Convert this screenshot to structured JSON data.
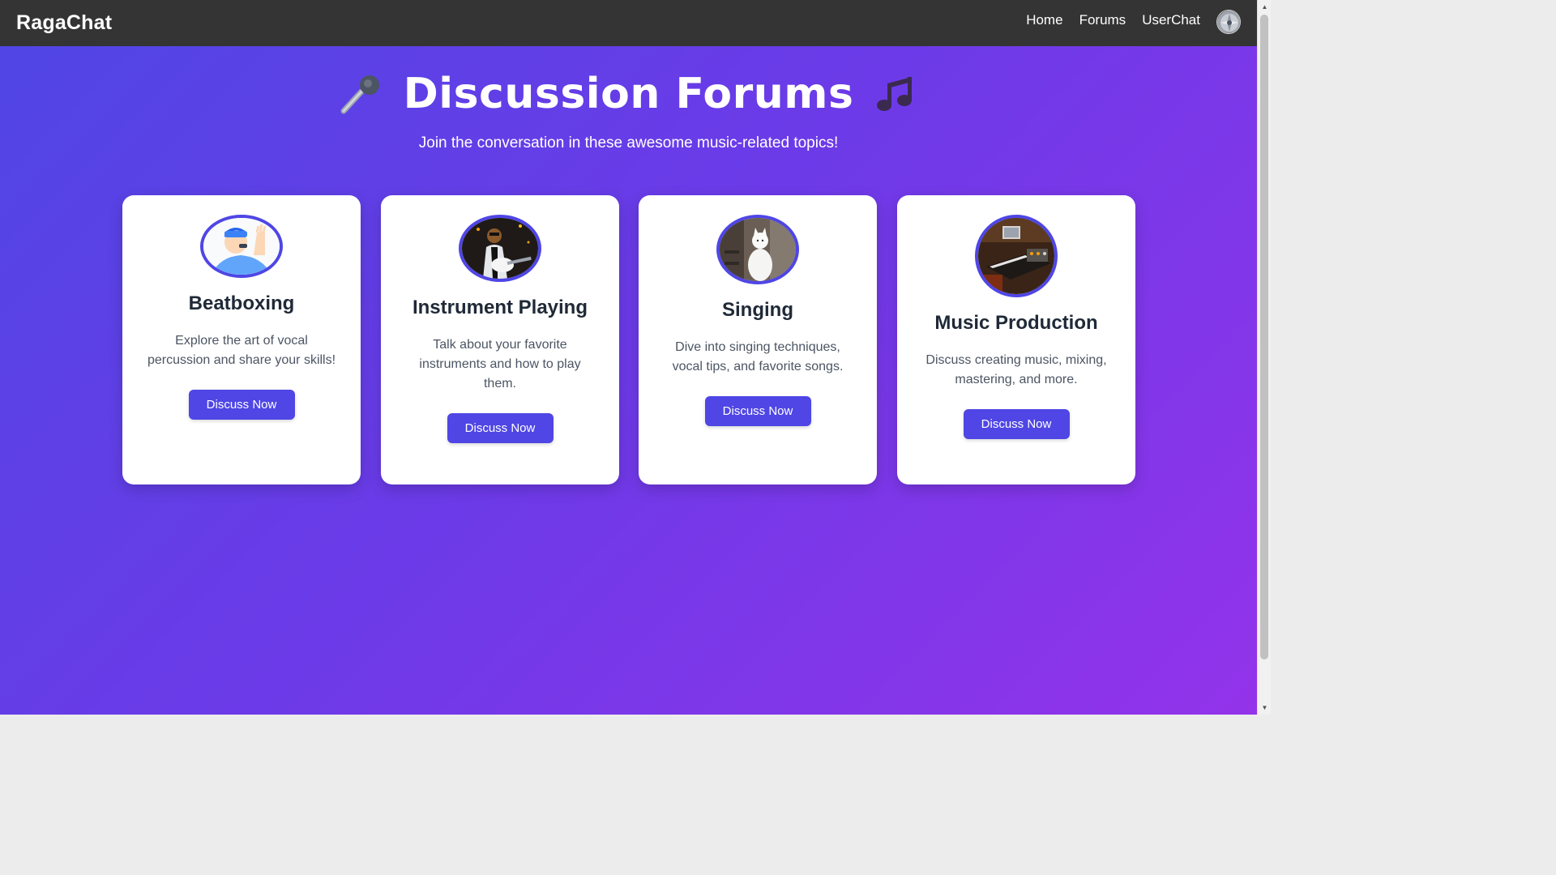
{
  "navbar": {
    "brand": "RagaChat",
    "links": [
      "Home",
      "Forums",
      "UserChat"
    ],
    "avatar": "user-avatar-icon"
  },
  "hero": {
    "title": "Discussion Forums",
    "left_emoji": "microphone-icon",
    "right_emoji": "musical-notes-icon",
    "subtitle": "Join the conversation in these awesome music-related topics!"
  },
  "cards": [
    {
      "title": "Beatboxing",
      "description": "Explore the art of vocal percussion and share your skills!",
      "button": "Discuss Now",
      "image": "beatboxer-cartoon-image"
    },
    {
      "title": "Instrument Playing",
      "description": "Talk about your favorite instruments and how to play them.",
      "button": "Discuss Now",
      "image": "guitar-player-photo"
    },
    {
      "title": "Singing",
      "description": "Dive into singing techniques, vocal tips, and favorite songs.",
      "button": "Discuss Now",
      "image": "singing-cat-photo"
    },
    {
      "title": "Music Production",
      "description": "Discuss creating music, mixing, mastering, and more.",
      "button": "Discuss Now",
      "image": "studio-equipment-photo"
    }
  ],
  "colors": {
    "navbar": "#343434",
    "accent": "#4f46e5",
    "gradient_start": "#4f46e5",
    "gradient_end": "#9333ea"
  }
}
